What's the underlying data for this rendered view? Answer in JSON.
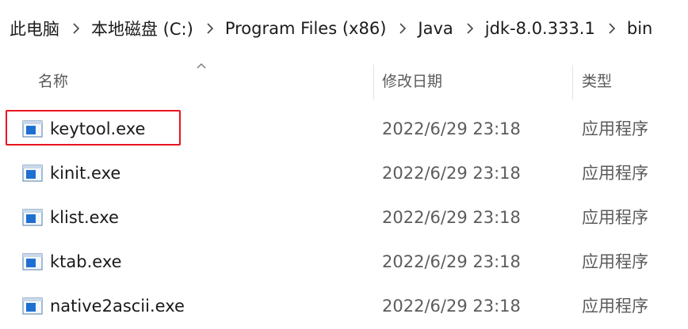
{
  "breadcrumb": {
    "items": [
      "此电脑",
      "本地磁盘 (C:)",
      "Program Files (x86)",
      "Java",
      "jdk-8.0.333.1",
      "bin"
    ]
  },
  "columns": {
    "name": "名称",
    "date": "修改日期",
    "type": "类型"
  },
  "files": [
    {
      "name": "keytool.exe",
      "date": "2022/6/29 23:18",
      "type": "应用程序",
      "highlighted": true
    },
    {
      "name": "kinit.exe",
      "date": "2022/6/29 23:18",
      "type": "应用程序",
      "highlighted": false
    },
    {
      "name": "klist.exe",
      "date": "2022/6/29 23:18",
      "type": "应用程序",
      "highlighted": false
    },
    {
      "name": "ktab.exe",
      "date": "2022/6/29 23:18",
      "type": "应用程序",
      "highlighted": false
    },
    {
      "name": "native2ascii.exe",
      "date": "2022/6/29 23:18",
      "type": "应用程序",
      "highlighted": false
    }
  ],
  "colors": {
    "highlight_border": "#e8141e",
    "icon_blue": "#1f6fd1"
  },
  "icons": {
    "breadcrumb_separator": "chevron-right-icon",
    "file": "exe-file-icon",
    "sort": "sort-ascending-caret-icon"
  }
}
